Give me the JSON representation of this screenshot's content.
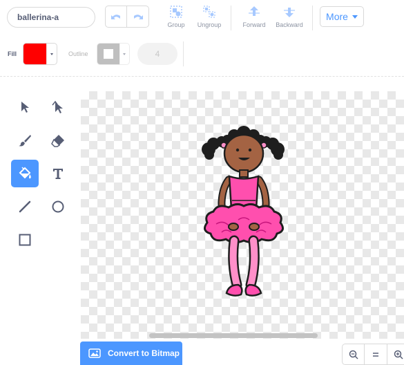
{
  "costume": {
    "name": "ballerina-a"
  },
  "toolbar": {
    "group_label": "Group",
    "ungroup_label": "Ungroup",
    "forward_label": "Forward",
    "backward_label": "Backward",
    "more_label": "More"
  },
  "properties": {
    "fill_label": "Fill",
    "fill_color": "#ff0000",
    "outline_label": "Outline",
    "outline_color": "#ffffff",
    "stroke_width": "4"
  },
  "tools": [
    {
      "name": "select",
      "active": false
    },
    {
      "name": "reshape",
      "active": false
    },
    {
      "name": "brush",
      "active": false
    },
    {
      "name": "eraser",
      "active": false
    },
    {
      "name": "fill",
      "active": true
    },
    {
      "name": "text",
      "active": false
    },
    {
      "name": "line",
      "active": false
    },
    {
      "name": "circle",
      "active": false
    },
    {
      "name": "rectangle",
      "active": false
    }
  ],
  "bottom": {
    "convert_label": "Convert to Bitmap",
    "zoom_out_icon": "zoom-out",
    "zoom_reset_icon": "equals",
    "zoom_in_icon": "zoom-in"
  },
  "colors": {
    "accent": "#4c97ff",
    "text": "#575e75",
    "dress": "#ff4fae"
  }
}
